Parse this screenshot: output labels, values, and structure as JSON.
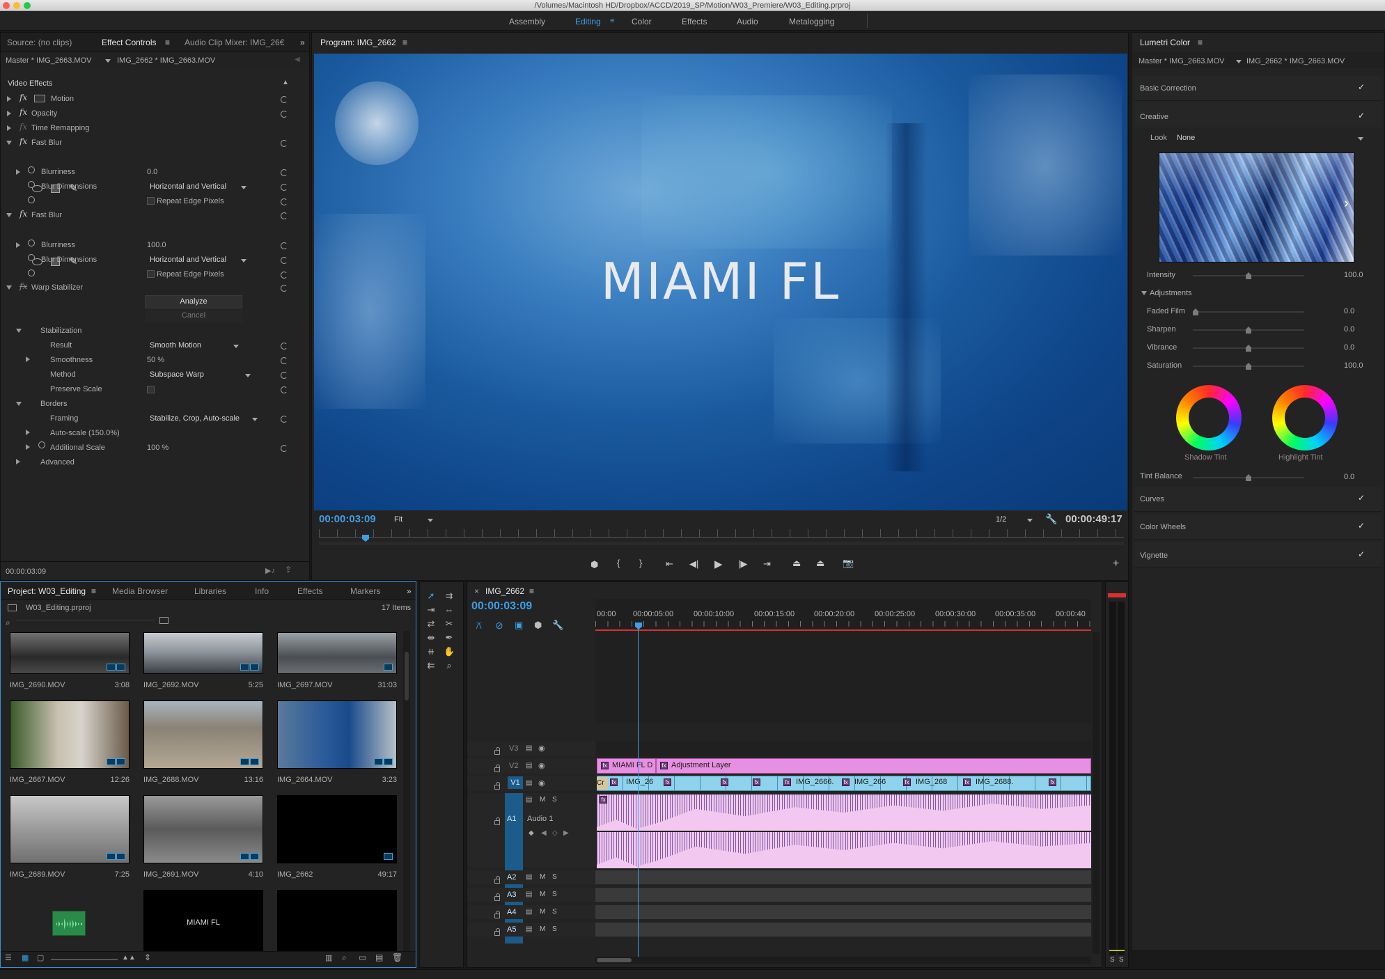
{
  "titlebar": {
    "path": "/Volumes/Macintosh HD/Dropbox/ACCD/2019_SP/Motion/W03_Premiere/W03_Editing.prproj"
  },
  "workspaces": [
    "Assembly",
    "Editing",
    "Color",
    "Effects",
    "Audio",
    "Metalogging"
  ],
  "effect_controls": {
    "tabs": [
      "Source: (no clips)",
      "Effect Controls",
      "Audio Clip Mixer: IMG_26€"
    ],
    "master": "Master * IMG_2663.MOV",
    "clip": "IMG_2662 * IMG_2663.MOV",
    "section": "Video Effects",
    "rows": {
      "motion": "Motion",
      "opacity": "Opacity",
      "time_remapping": "Time Remapping",
      "fast_blur_1": "Fast Blur",
      "blurriness_1": "Blurriness",
      "blurriness_1_val": "0.0",
      "blur_dim_1": "Blur Dimensions",
      "blur_dim_1_val": "Horizontal and Vertical",
      "repeat_1": "Repeat Edge Pixels",
      "fast_blur_2": "Fast Blur",
      "blurriness_2": "Blurriness",
      "blurriness_2_val": "100.0",
      "blur_dim_2": "Blur Dimensions",
      "blur_dim_2_val": "Horizontal and Vertical",
      "repeat_2": "Repeat Edge Pixels",
      "warp": "Warp Stabilizer",
      "analyze": "Analyze",
      "cancel": "Cancel",
      "stabilization": "Stabilization",
      "result": "Result",
      "result_val": "Smooth Motion",
      "smoothness": "Smoothness",
      "smoothness_val": "50 %",
      "method": "Method",
      "method_val": "Subspace Warp",
      "preserve": "Preserve Scale",
      "borders": "Borders",
      "framing": "Framing",
      "framing_val": "Stabilize, Crop, Auto-scale",
      "autoscale": "Auto-scale (150.0%)",
      "add_scale": "Additional Scale",
      "add_scale_val": "100 %",
      "advanced": "Advanced"
    },
    "timecode": "00:00:03:09"
  },
  "program": {
    "title": "Program: IMG_2662",
    "overlay_text": "MIAMI FL",
    "timecode": "00:00:03:09",
    "fit": "Fit",
    "resolution": "1/2",
    "duration": "00:00:49:17"
  },
  "lumetri": {
    "title": "Lumetri Color",
    "master": "Master * IMG_2663.MOV",
    "clip": "IMG_2662 * IMG_2663.MOV",
    "basic": "Basic Correction",
    "creative": "Creative",
    "look_label": "Look",
    "look_val": "None",
    "intensity_label": "Intensity",
    "intensity_val": "100.0",
    "intensity": 0.5,
    "adjustments": "Adjustments",
    "faded_label": "Faded Film",
    "faded_val": "0.0",
    "faded": 0.0,
    "sharpen_label": "Sharpen",
    "sharpen_val": "0.0",
    "sharpen": 0.5,
    "vibrance_label": "Vibrance",
    "vibrance_val": "0.0",
    "vibrance": 0.5,
    "saturation_label": "Saturation",
    "saturation_val": "100.0",
    "saturation": 0.5,
    "shadow_tint": "Shadow Tint",
    "highlight_tint": "Highlight Tint",
    "tint_balance_label": "Tint Balance",
    "tint_balance_val": "0.0",
    "tint_balance": 0.5,
    "curves": "Curves",
    "color_wheels": "Color Wheels",
    "vignette": "Vignette"
  },
  "project": {
    "tabs": [
      "Project: W03_Editing",
      "Media Browser",
      "Libraries",
      "Info",
      "Effects",
      "Markers"
    ],
    "file": "W03_Editing.prproj",
    "items_count": "17 Items",
    "clips": [
      {
        "name": "IMG_2690.MOV",
        "dur": "3:08"
      },
      {
        "name": "IMG_2692.MOV",
        "dur": "5:25"
      },
      {
        "name": "IMG_2697.MOV",
        "dur": "31:03"
      },
      {
        "name": "IMG_2667.MOV",
        "dur": "12:26"
      },
      {
        "name": "IMG_2688.MOV",
        "dur": "13:16"
      },
      {
        "name": "IMG_2664.MOV",
        "dur": "3:23"
      },
      {
        "name": "IMG_2689.MOV",
        "dur": "7:25"
      },
      {
        "name": "IMG_2691.MOV",
        "dur": "4:10"
      },
      {
        "name": "IMG_2662",
        "dur": "49:17"
      }
    ],
    "miami_thumb_text": "MIAMI FL"
  },
  "timeline": {
    "tab": "IMG_2662",
    "timecode": "00:00:03:09",
    "ruler": [
      "00:00",
      "00:00:05:00",
      "00:00:10:00",
      "00:00:15:00",
      "00:00:20:00",
      "00:00:25:00",
      "00:00:30:00",
      "00:00:35:00",
      "00:00:40"
    ],
    "tracks": {
      "v3": "V3",
      "v2": "V2",
      "v1": "V1",
      "a1": "A1",
      "audio1": "Audio 1",
      "a2": "A2",
      "a3": "A3",
      "a4": "A4",
      "a5": "A5"
    },
    "m": "M",
    "s": "S",
    "clips_v2": [
      "MIAMI FL D",
      "Adjustment Layer"
    ],
    "clips_v1": [
      "Cr",
      "IMG_26",
      "IMG_2666.",
      "IMG_266",
      "IMG_268",
      "IMG_2688."
    ]
  },
  "meter": {
    "labels": [
      "S",
      "S"
    ]
  }
}
